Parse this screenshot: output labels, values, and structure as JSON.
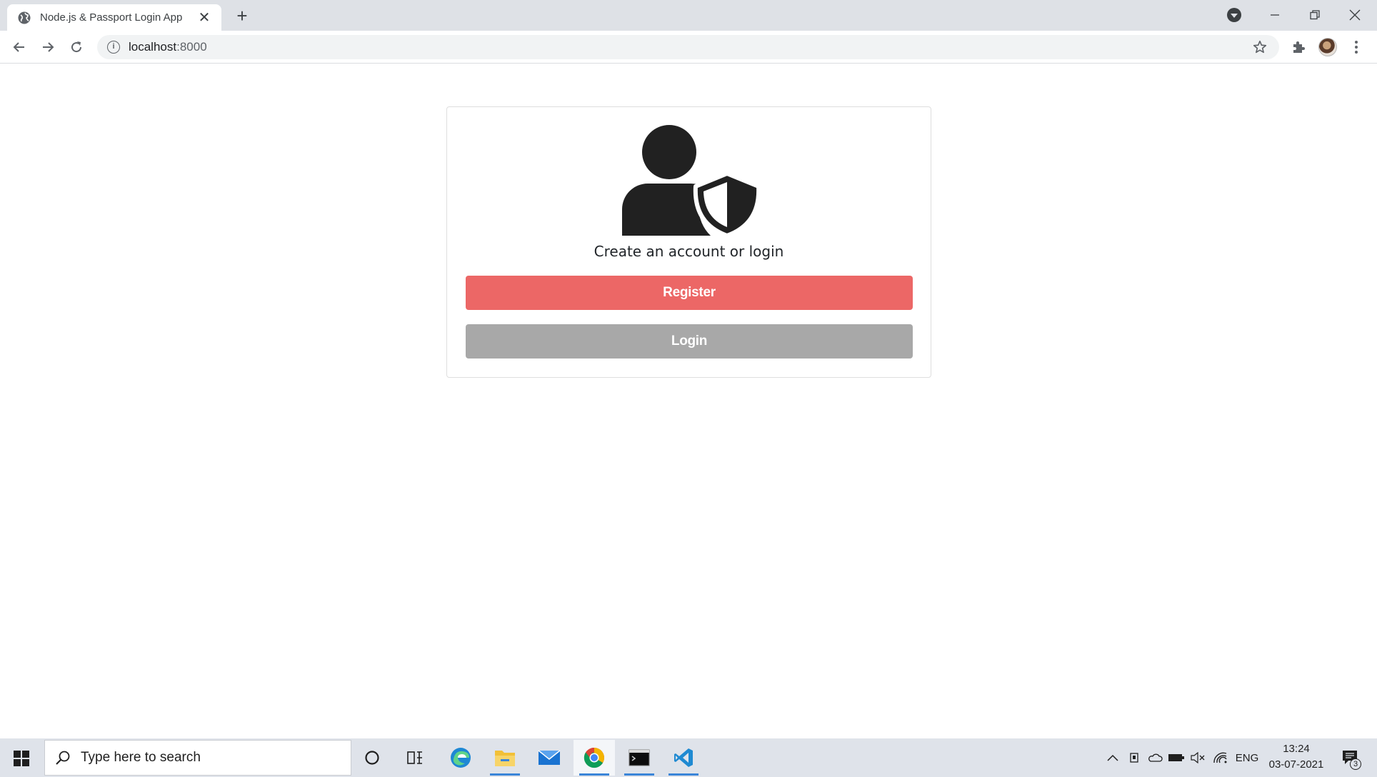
{
  "browser": {
    "tab_title": "Node.js & Passport Login App",
    "tab_close": "✕",
    "new_tab": "+",
    "url_host": "localhost",
    "url_port": ":8000"
  },
  "page": {
    "caption": "Create an account or login",
    "register_label": "Register",
    "login_label": "Login",
    "colors": {
      "register": "#ec6766",
      "login": "#a8a8a8",
      "icon": "#212121"
    }
  },
  "taskbar": {
    "search_placeholder": "Type here to search",
    "language": "ENG",
    "time": "13:24",
    "date": "03-07-2021",
    "notification_count": "3"
  }
}
